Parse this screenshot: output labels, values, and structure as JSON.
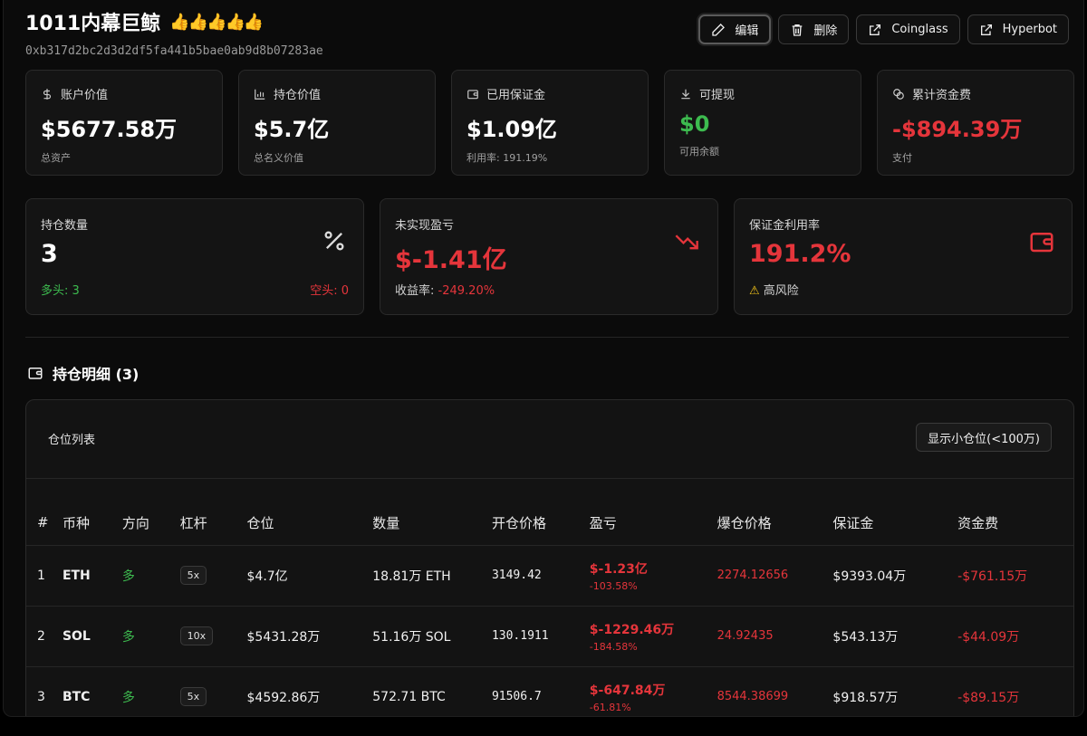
{
  "header": {
    "title": "1011内幕巨鲸",
    "thumbs": "👍👍👍👍👍",
    "address": "0xb317d2bc2d3d2df5fa441b5bae0ab9d8b07283ae",
    "buttons": {
      "edit": "编辑",
      "delete": "删除",
      "coinglass": "Coinglass",
      "hyperbot": "Hyperbot"
    }
  },
  "stats": [
    {
      "label": "账户价值",
      "value": "$5677.58万",
      "sub": "总资产",
      "icon": "dollar-icon"
    },
    {
      "label": "持仓价值",
      "value": "$5.7亿",
      "sub": "总名义价值",
      "icon": "bar-chart-icon"
    },
    {
      "label": "已用保证金",
      "value": "$1.09亿",
      "sub": "利用率: 191.19%",
      "icon": "wallet-icon"
    },
    {
      "label": "可提现",
      "value": "$0",
      "sub": "可用余额",
      "icon": "download-icon"
    },
    {
      "label": "累计资金费",
      "value": "-$894.39万",
      "sub": "支付",
      "icon": "coins-icon"
    }
  ],
  "summary": {
    "positions": {
      "label": "持仓数量",
      "value": "3",
      "long": "多头: 3",
      "short": "空头: 0",
      "icon": "percent-icon"
    },
    "unrealized": {
      "label": "未实现盈亏",
      "value": "$-1.41亿",
      "roe_label": "收益率:",
      "roe": "-249.20%",
      "icon": "trend-down-icon"
    },
    "margin_usage": {
      "label": "保证金利用率",
      "value": "191.2%",
      "warning": "高风险",
      "icon": "wallet-icon"
    }
  },
  "section": {
    "title": "持仓明细 (3)"
  },
  "table": {
    "title": "仓位列表",
    "toggle": "显示小仓位(<100万)",
    "columns": [
      "#",
      "币种",
      "方向",
      "杠杆",
      "仓位",
      "数量",
      "开仓价格",
      "盈亏",
      "爆仓价格",
      "保证金",
      "资金费"
    ],
    "rows": [
      {
        "idx": "1",
        "coin": "ETH",
        "side": "多",
        "lev": "5x",
        "size": "$4.7亿",
        "qty": "18.81万 ETH",
        "entry": "3149.42",
        "pnl": "$-1.23亿",
        "pnl_pct": "-103.58%",
        "liq": "2274.12656",
        "margin": "$9393.04万",
        "funding": "-$761.15万"
      },
      {
        "idx": "2",
        "coin": "SOL",
        "side": "多",
        "lev": "10x",
        "size": "$5431.28万",
        "qty": "51.16万 SOL",
        "entry": "130.1911",
        "pnl": "$-1229.46万",
        "pnl_pct": "-184.58%",
        "liq": "24.92435",
        "margin": "$543.13万",
        "funding": "-$44.09万"
      },
      {
        "idx": "3",
        "coin": "BTC",
        "side": "多",
        "lev": "5x",
        "size": "$4592.86万",
        "qty": "572.71 BTC",
        "entry": "91506.7",
        "pnl": "$-647.84万",
        "pnl_pct": "-61.81%",
        "liq": "8544.38699",
        "margin": "$918.57万",
        "funding": "-$89.15万"
      }
    ]
  },
  "colors": {
    "green": "#3dbb4f",
    "red": "#e5353b",
    "warning": "#f5c518"
  }
}
